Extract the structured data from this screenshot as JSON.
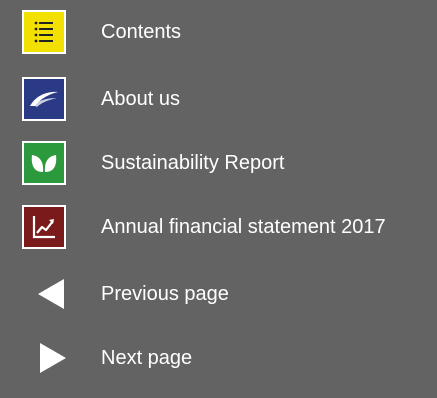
{
  "nav": {
    "items": [
      {
        "label": "Contents",
        "icon": "list-icon",
        "color": "#f2e000"
      },
      {
        "label": "About us",
        "icon": "logo-swoosh-icon",
        "color": "#2a3a85"
      },
      {
        "label": "Sustainability Report",
        "icon": "leaf-icon",
        "color": "#2c9a3c"
      },
      {
        "label": "Annual financial statement 2017",
        "icon": "trend-chart-icon",
        "color": "#7a1a1a"
      },
      {
        "label": "Previous page",
        "icon": "arrow-left-icon"
      },
      {
        "label": "Next page",
        "icon": "arrow-right-icon"
      }
    ]
  }
}
